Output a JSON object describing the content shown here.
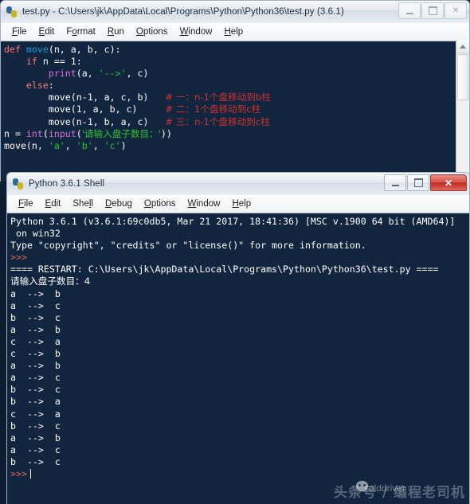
{
  "editor_window": {
    "title": "test.py - C:\\Users\\jk\\AppData\\Local\\Programs\\Python\\Python36\\test.py (3.6.1)",
    "icon": "python-file-icon",
    "controls": {
      "minimize": "–",
      "maximize": "□",
      "close": "╳"
    },
    "menus": [
      {
        "label": "File",
        "accel": "F"
      },
      {
        "label": "Edit",
        "accel": "E"
      },
      {
        "label": "Format",
        "accel": "o"
      },
      {
        "label": "Run",
        "accel": "R"
      },
      {
        "label": "Options",
        "accel": "O"
      },
      {
        "label": "Window",
        "accel": "W"
      },
      {
        "label": "Help",
        "accel": "H"
      }
    ],
    "code_lines": [
      [
        {
          "t": "def ",
          "c": "kw"
        },
        {
          "t": "move",
          "c": "fname"
        },
        {
          "t": "(n, a, b, c):",
          "c": "plain"
        }
      ],
      [
        {
          "t": "    ",
          "c": "plain"
        },
        {
          "t": "if ",
          "c": "kw"
        },
        {
          "t": "n == 1:",
          "c": "plain"
        }
      ],
      [
        {
          "t": "        ",
          "c": "plain"
        },
        {
          "t": "print",
          "c": "builtin"
        },
        {
          "t": "(a, ",
          "c": "plain"
        },
        {
          "t": "'-->'",
          "c": "str"
        },
        {
          "t": ", c)",
          "c": "plain"
        }
      ],
      [
        {
          "t": "    ",
          "c": "plain"
        },
        {
          "t": "else",
          "c": "kw"
        },
        {
          "t": ":",
          "c": "plain"
        }
      ],
      [
        {
          "t": "        move(n-1, a, c, b)   ",
          "c": "plain"
        },
        {
          "t": "# 一：n-1个盘移动到b柱",
          "c": "cmt"
        }
      ],
      [
        {
          "t": "        move(1, a, b, c)     ",
          "c": "plain"
        },
        {
          "t": "# 二：1个盘移动到c柱",
          "c": "cmt"
        }
      ],
      [
        {
          "t": "        move(n-1, b, a, c)   ",
          "c": "plain"
        },
        {
          "t": "# 三：n-1个盘移动到c柱",
          "c": "cmt"
        }
      ],
      [
        {
          "t": "n = ",
          "c": "plain"
        },
        {
          "t": "int",
          "c": "builtin"
        },
        {
          "t": "(",
          "c": "plain"
        },
        {
          "t": "input",
          "c": "builtin"
        },
        {
          "t": "(",
          "c": "plain"
        },
        {
          "t": "'请输入盘子数目：'",
          "c": "str"
        },
        {
          "t": "))",
          "c": "plain"
        }
      ],
      [
        {
          "t": "move(n, ",
          "c": "plain"
        },
        {
          "t": "'a'",
          "c": "str"
        },
        {
          "t": ", ",
          "c": "plain"
        },
        {
          "t": "'b'",
          "c": "str"
        },
        {
          "t": ", ",
          "c": "plain"
        },
        {
          "t": "'c'",
          "c": "str"
        },
        {
          "t": ")",
          "c": "plain"
        }
      ]
    ]
  },
  "shell_window": {
    "title": "Python 3.6.1 Shell",
    "icon": "python-shell-icon",
    "controls": {
      "minimize": "–",
      "maximize": "□",
      "close": "╳"
    },
    "menus": [
      {
        "label": "File",
        "accel": "F"
      },
      {
        "label": "Edit",
        "accel": "E"
      },
      {
        "label": "Shell",
        "accel": "l"
      },
      {
        "label": "Debug",
        "accel": "D"
      },
      {
        "label": "Options",
        "accel": "O"
      },
      {
        "label": "Window",
        "accel": "W"
      },
      {
        "label": "Help",
        "accel": "H"
      }
    ],
    "output_lines": [
      [
        {
          "t": "Python 3.6.1 (v3.6.1:69c0db5, Mar 21 2017, 18:41:36) [MSC v.1900 64 bit (AMD64)]",
          "c": "plain"
        }
      ],
      [
        {
          "t": " on win32",
          "c": "plain"
        }
      ],
      [
        {
          "t": "Type \"copyright\", \"credits\" or \"license()\" for more information.",
          "c": "plain"
        }
      ],
      [
        {
          "t": ">>>",
          "c": "outprompt"
        }
      ],
      [
        {
          "t": "==== RESTART: C:\\Users\\jk\\AppData\\Local\\Programs\\Python\\Python36\\test.py ====",
          "c": "plain"
        }
      ],
      [
        {
          "t": "请输入盘子数目：4",
          "c": "plain"
        }
      ],
      [
        {
          "t": "a  -->  b",
          "c": "plain"
        }
      ],
      [
        {
          "t": "a  -->  c",
          "c": "plain"
        }
      ],
      [
        {
          "t": "b  -->  c",
          "c": "plain"
        }
      ],
      [
        {
          "t": "a  -->  b",
          "c": "plain"
        }
      ],
      [
        {
          "t": "c  -->  a",
          "c": "plain"
        }
      ],
      [
        {
          "t": "c  -->  b",
          "c": "plain"
        }
      ],
      [
        {
          "t": "a  -->  b",
          "c": "plain"
        }
      ],
      [
        {
          "t": "a  -->  c",
          "c": "plain"
        }
      ],
      [
        {
          "t": "b  -->  c",
          "c": "plain"
        }
      ],
      [
        {
          "t": "b  -->  a",
          "c": "plain"
        }
      ],
      [
        {
          "t": "c  -->  a",
          "c": "plain"
        }
      ],
      [
        {
          "t": "b  -->  c",
          "c": "plain"
        }
      ],
      [
        {
          "t": "a  -->  b",
          "c": "plain"
        }
      ],
      [
        {
          "t": "a  -->  c",
          "c": "plain"
        }
      ],
      [
        {
          "t": "b  -->  c",
          "c": "plain"
        }
      ]
    ],
    "final_prompt": ">>>",
    "disk_count_entered": "4"
  },
  "watermark": {
    "text": "头条号 / 编程老司机",
    "overlay": "olddriver",
    "badge": "wechat-icon"
  },
  "colors": {
    "editor_background": "#11253f",
    "keyword": "#ff7575",
    "function_name": "#1d9bd6",
    "builtin": "#d96fd9",
    "string": "#2fc22f",
    "comment": "#d2302f",
    "output_text": "#ffffff",
    "prompt": "#e1674f",
    "close_button": "#bd2a22"
  }
}
